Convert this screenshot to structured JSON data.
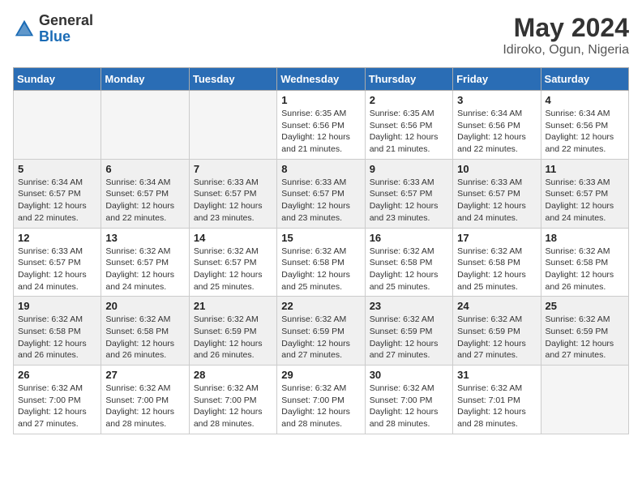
{
  "header": {
    "logo_general": "General",
    "logo_blue": "Blue",
    "month_year": "May 2024",
    "location": "Idiroko, Ogun, Nigeria"
  },
  "weekdays": [
    "Sunday",
    "Monday",
    "Tuesday",
    "Wednesday",
    "Thursday",
    "Friday",
    "Saturday"
  ],
  "weeks": [
    [
      {
        "day": "",
        "info": ""
      },
      {
        "day": "",
        "info": ""
      },
      {
        "day": "",
        "info": ""
      },
      {
        "day": "1",
        "info": "Sunrise: 6:35 AM\nSunset: 6:56 PM\nDaylight: 12 hours\nand 21 minutes."
      },
      {
        "day": "2",
        "info": "Sunrise: 6:35 AM\nSunset: 6:56 PM\nDaylight: 12 hours\nand 21 minutes."
      },
      {
        "day": "3",
        "info": "Sunrise: 6:34 AM\nSunset: 6:56 PM\nDaylight: 12 hours\nand 22 minutes."
      },
      {
        "day": "4",
        "info": "Sunrise: 6:34 AM\nSunset: 6:56 PM\nDaylight: 12 hours\nand 22 minutes."
      }
    ],
    [
      {
        "day": "5",
        "info": "Sunrise: 6:34 AM\nSunset: 6:57 PM\nDaylight: 12 hours\nand 22 minutes."
      },
      {
        "day": "6",
        "info": "Sunrise: 6:34 AM\nSunset: 6:57 PM\nDaylight: 12 hours\nand 22 minutes."
      },
      {
        "day": "7",
        "info": "Sunrise: 6:33 AM\nSunset: 6:57 PM\nDaylight: 12 hours\nand 23 minutes."
      },
      {
        "day": "8",
        "info": "Sunrise: 6:33 AM\nSunset: 6:57 PM\nDaylight: 12 hours\nand 23 minutes."
      },
      {
        "day": "9",
        "info": "Sunrise: 6:33 AM\nSunset: 6:57 PM\nDaylight: 12 hours\nand 23 minutes."
      },
      {
        "day": "10",
        "info": "Sunrise: 6:33 AM\nSunset: 6:57 PM\nDaylight: 12 hours\nand 24 minutes."
      },
      {
        "day": "11",
        "info": "Sunrise: 6:33 AM\nSunset: 6:57 PM\nDaylight: 12 hours\nand 24 minutes."
      }
    ],
    [
      {
        "day": "12",
        "info": "Sunrise: 6:33 AM\nSunset: 6:57 PM\nDaylight: 12 hours\nand 24 minutes."
      },
      {
        "day": "13",
        "info": "Sunrise: 6:32 AM\nSunset: 6:57 PM\nDaylight: 12 hours\nand 24 minutes."
      },
      {
        "day": "14",
        "info": "Sunrise: 6:32 AM\nSunset: 6:57 PM\nDaylight: 12 hours\nand 25 minutes."
      },
      {
        "day": "15",
        "info": "Sunrise: 6:32 AM\nSunset: 6:58 PM\nDaylight: 12 hours\nand 25 minutes."
      },
      {
        "day": "16",
        "info": "Sunrise: 6:32 AM\nSunset: 6:58 PM\nDaylight: 12 hours\nand 25 minutes."
      },
      {
        "day": "17",
        "info": "Sunrise: 6:32 AM\nSunset: 6:58 PM\nDaylight: 12 hours\nand 25 minutes."
      },
      {
        "day": "18",
        "info": "Sunrise: 6:32 AM\nSunset: 6:58 PM\nDaylight: 12 hours\nand 26 minutes."
      }
    ],
    [
      {
        "day": "19",
        "info": "Sunrise: 6:32 AM\nSunset: 6:58 PM\nDaylight: 12 hours\nand 26 minutes."
      },
      {
        "day": "20",
        "info": "Sunrise: 6:32 AM\nSunset: 6:58 PM\nDaylight: 12 hours\nand 26 minutes."
      },
      {
        "day": "21",
        "info": "Sunrise: 6:32 AM\nSunset: 6:59 PM\nDaylight: 12 hours\nand 26 minutes."
      },
      {
        "day": "22",
        "info": "Sunrise: 6:32 AM\nSunset: 6:59 PM\nDaylight: 12 hours\nand 27 minutes."
      },
      {
        "day": "23",
        "info": "Sunrise: 6:32 AM\nSunset: 6:59 PM\nDaylight: 12 hours\nand 27 minutes."
      },
      {
        "day": "24",
        "info": "Sunrise: 6:32 AM\nSunset: 6:59 PM\nDaylight: 12 hours\nand 27 minutes."
      },
      {
        "day": "25",
        "info": "Sunrise: 6:32 AM\nSunset: 6:59 PM\nDaylight: 12 hours\nand 27 minutes."
      }
    ],
    [
      {
        "day": "26",
        "info": "Sunrise: 6:32 AM\nSunset: 7:00 PM\nDaylight: 12 hours\nand 27 minutes."
      },
      {
        "day": "27",
        "info": "Sunrise: 6:32 AM\nSunset: 7:00 PM\nDaylight: 12 hours\nand 28 minutes."
      },
      {
        "day": "28",
        "info": "Sunrise: 6:32 AM\nSunset: 7:00 PM\nDaylight: 12 hours\nand 28 minutes."
      },
      {
        "day": "29",
        "info": "Sunrise: 6:32 AM\nSunset: 7:00 PM\nDaylight: 12 hours\nand 28 minutes."
      },
      {
        "day": "30",
        "info": "Sunrise: 6:32 AM\nSunset: 7:00 PM\nDaylight: 12 hours\nand 28 minutes."
      },
      {
        "day": "31",
        "info": "Sunrise: 6:32 AM\nSunset: 7:01 PM\nDaylight: 12 hours\nand 28 minutes."
      },
      {
        "day": "",
        "info": ""
      }
    ]
  ]
}
